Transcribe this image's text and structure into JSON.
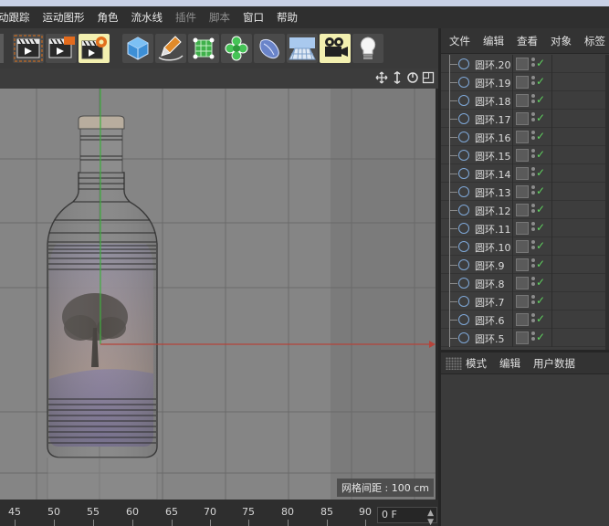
{
  "menu": {
    "items": [
      {
        "label": "动跟踪",
        "dim": false
      },
      {
        "label": "运动图形",
        "dim": false
      },
      {
        "label": "角色",
        "dim": false
      },
      {
        "label": "流水线",
        "dim": false
      },
      {
        "label": "插件",
        "dim": true
      },
      {
        "label": "脚本",
        "dim": true
      },
      {
        "label": "窗口",
        "dim": false
      },
      {
        "label": "帮助",
        "dim": false
      }
    ]
  },
  "toolbar": {
    "buttons": [
      {
        "name": "render-region-icon"
      },
      {
        "name": "render-view-icon"
      },
      {
        "name": "render-settings-icon"
      },
      {
        "name": "cube-icon"
      },
      {
        "name": "pen-spline-icon"
      },
      {
        "name": "subdivision-icon"
      },
      {
        "name": "cloner-icon"
      },
      {
        "name": "deformer-icon"
      },
      {
        "name": "floor-icon"
      },
      {
        "name": "camera-icon"
      },
      {
        "name": "light-icon"
      }
    ]
  },
  "viewport": {
    "grid_spacing_label": "网格间距 : 100 cm",
    "nav_icons": [
      "move-view-icon",
      "zoom-view-icon",
      "rotate-view-icon",
      "maximize-view-icon"
    ]
  },
  "timeline": {
    "ticks": [
      "45",
      "50",
      "55",
      "60",
      "65",
      "70",
      "75",
      "80",
      "85",
      "90"
    ],
    "current_frame": "0 F"
  },
  "object_manager": {
    "tabs": [
      "文件",
      "编辑",
      "查看",
      "对象",
      "标签"
    ],
    "objects": [
      {
        "name": "圆环.20"
      },
      {
        "name": "圆环.19"
      },
      {
        "name": "圆环.18"
      },
      {
        "name": "圆环.17"
      },
      {
        "name": "圆环.16"
      },
      {
        "name": "圆环.15"
      },
      {
        "name": "圆环.14"
      },
      {
        "name": "圆环.13"
      },
      {
        "name": "圆环.12"
      },
      {
        "name": "圆环.11"
      },
      {
        "name": "圆环.10"
      },
      {
        "name": "圆环.9"
      },
      {
        "name": "圆环.8"
      },
      {
        "name": "圆环.7"
      },
      {
        "name": "圆环.6"
      },
      {
        "name": "圆环.5"
      }
    ]
  },
  "attribute_manager": {
    "tabs": [
      "模式",
      "编辑",
      "用户数据"
    ]
  },
  "colors": {
    "menu_bg": "#2f2f2f",
    "viewport_bg": "#858585",
    "highlight_button": "#f3f0b0",
    "check_green": "#5fd35f",
    "ring_blue": "#7fa8d8",
    "axis_red": "#b4433a",
    "axis_green": "#3fae3f"
  }
}
